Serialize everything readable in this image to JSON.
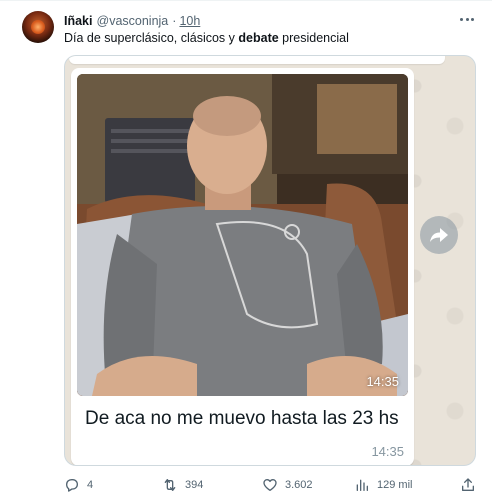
{
  "tweet": {
    "display_name": "Iñaki",
    "handle": "@vasconinja",
    "separator": "·",
    "time": "10h",
    "text_before": "Día de superclásico, clásicos y ",
    "text_bold": "debate",
    "text_after": " presidencial"
  },
  "media": {
    "photo_time": "14:35",
    "message": "De aca no me muevo hasta las 23 hs",
    "message_time": "14:35"
  },
  "actions": {
    "replies": "4",
    "retweets": "394",
    "likes": "3.602",
    "views": "129 mil"
  },
  "icons": {
    "more": "more-horizontal-icon",
    "forward": "forward-arrow-icon",
    "reply": "reply-icon",
    "retweet": "retweet-icon",
    "like": "heart-icon",
    "views": "views-chart-icon",
    "share": "share-icon"
  },
  "colors": {
    "text": "#0f1419",
    "secondary": "#536471",
    "whatsapp_bg": "#e9e3d9",
    "bubble_time": "#8696a0"
  }
}
